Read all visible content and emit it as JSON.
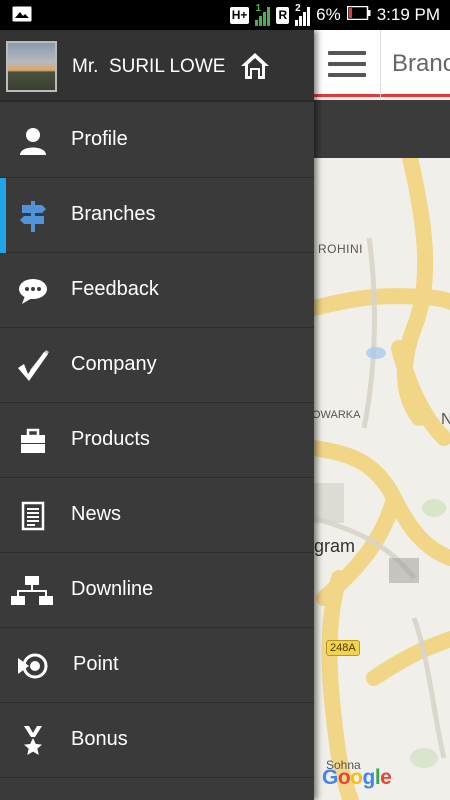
{
  "status_bar": {
    "network": "H+",
    "sim1_label": "1",
    "roaming_label": "R",
    "sim2_label": "2",
    "battery": "6%",
    "time": "3:19 PM"
  },
  "app": {
    "title": "Branc",
    "map": {
      "labels": [
        "ROHINI",
        "OWARKA",
        "N",
        "gram",
        "Sohna"
      ],
      "highway_shield": "248A",
      "attribution": "Google"
    }
  },
  "drawer": {
    "user_name": "Mr.  SURIL LOWE",
    "items": [
      {
        "label": "Profile",
        "icon": "person-icon"
      },
      {
        "label": "Branches",
        "icon": "signpost-icon"
      },
      {
        "label": "Feedback",
        "icon": "chat-bubble-icon"
      },
      {
        "label": "Company",
        "icon": "check-mark-icon"
      },
      {
        "label": "Products",
        "icon": "briefcase-icon"
      },
      {
        "label": "News",
        "icon": "newspaper-icon"
      },
      {
        "label": "Downline",
        "icon": "org-chart-icon"
      },
      {
        "label": "Point",
        "icon": "target-icon"
      },
      {
        "label": "Bonus",
        "icon": "medal-icon"
      }
    ],
    "active_item": "Branches"
  },
  "colors": {
    "drawer_bg": "#3a3a3a",
    "accent": "#1fa6e8",
    "toolbar_underline": "#e23b3b",
    "icon_active": "#4f93d9"
  }
}
